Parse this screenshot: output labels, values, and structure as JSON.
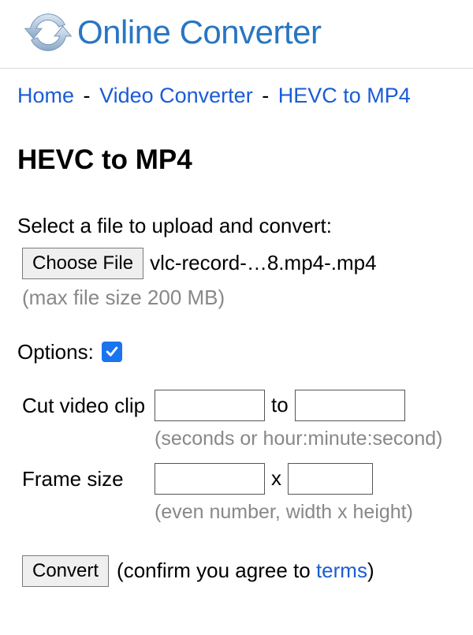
{
  "site": {
    "title": "Online Converter"
  },
  "breadcrumb": {
    "home": "Home",
    "sep": "-",
    "video_converter": "Video Converter",
    "current": "HEVC to MP4"
  },
  "page_title": "HEVC to MP4",
  "select_label": "Select a file to upload and convert:",
  "file": {
    "choose_label": "Choose File",
    "filename": "vlc-record-…8.mp4-.mp4",
    "size_hint": "(max file size 200 MB)"
  },
  "options": {
    "label": "Options:",
    "checked": true
  },
  "cut": {
    "label": "Cut video clip",
    "to": "to",
    "hint": "(seconds or hour:minute:second)"
  },
  "frame": {
    "label": "Frame size",
    "x": "x",
    "hint": "(even number, width x height)"
  },
  "convert": {
    "button": "Convert",
    "confirm_prefix": "(confirm you agree to ",
    "terms": "terms",
    "confirm_suffix": ")"
  }
}
